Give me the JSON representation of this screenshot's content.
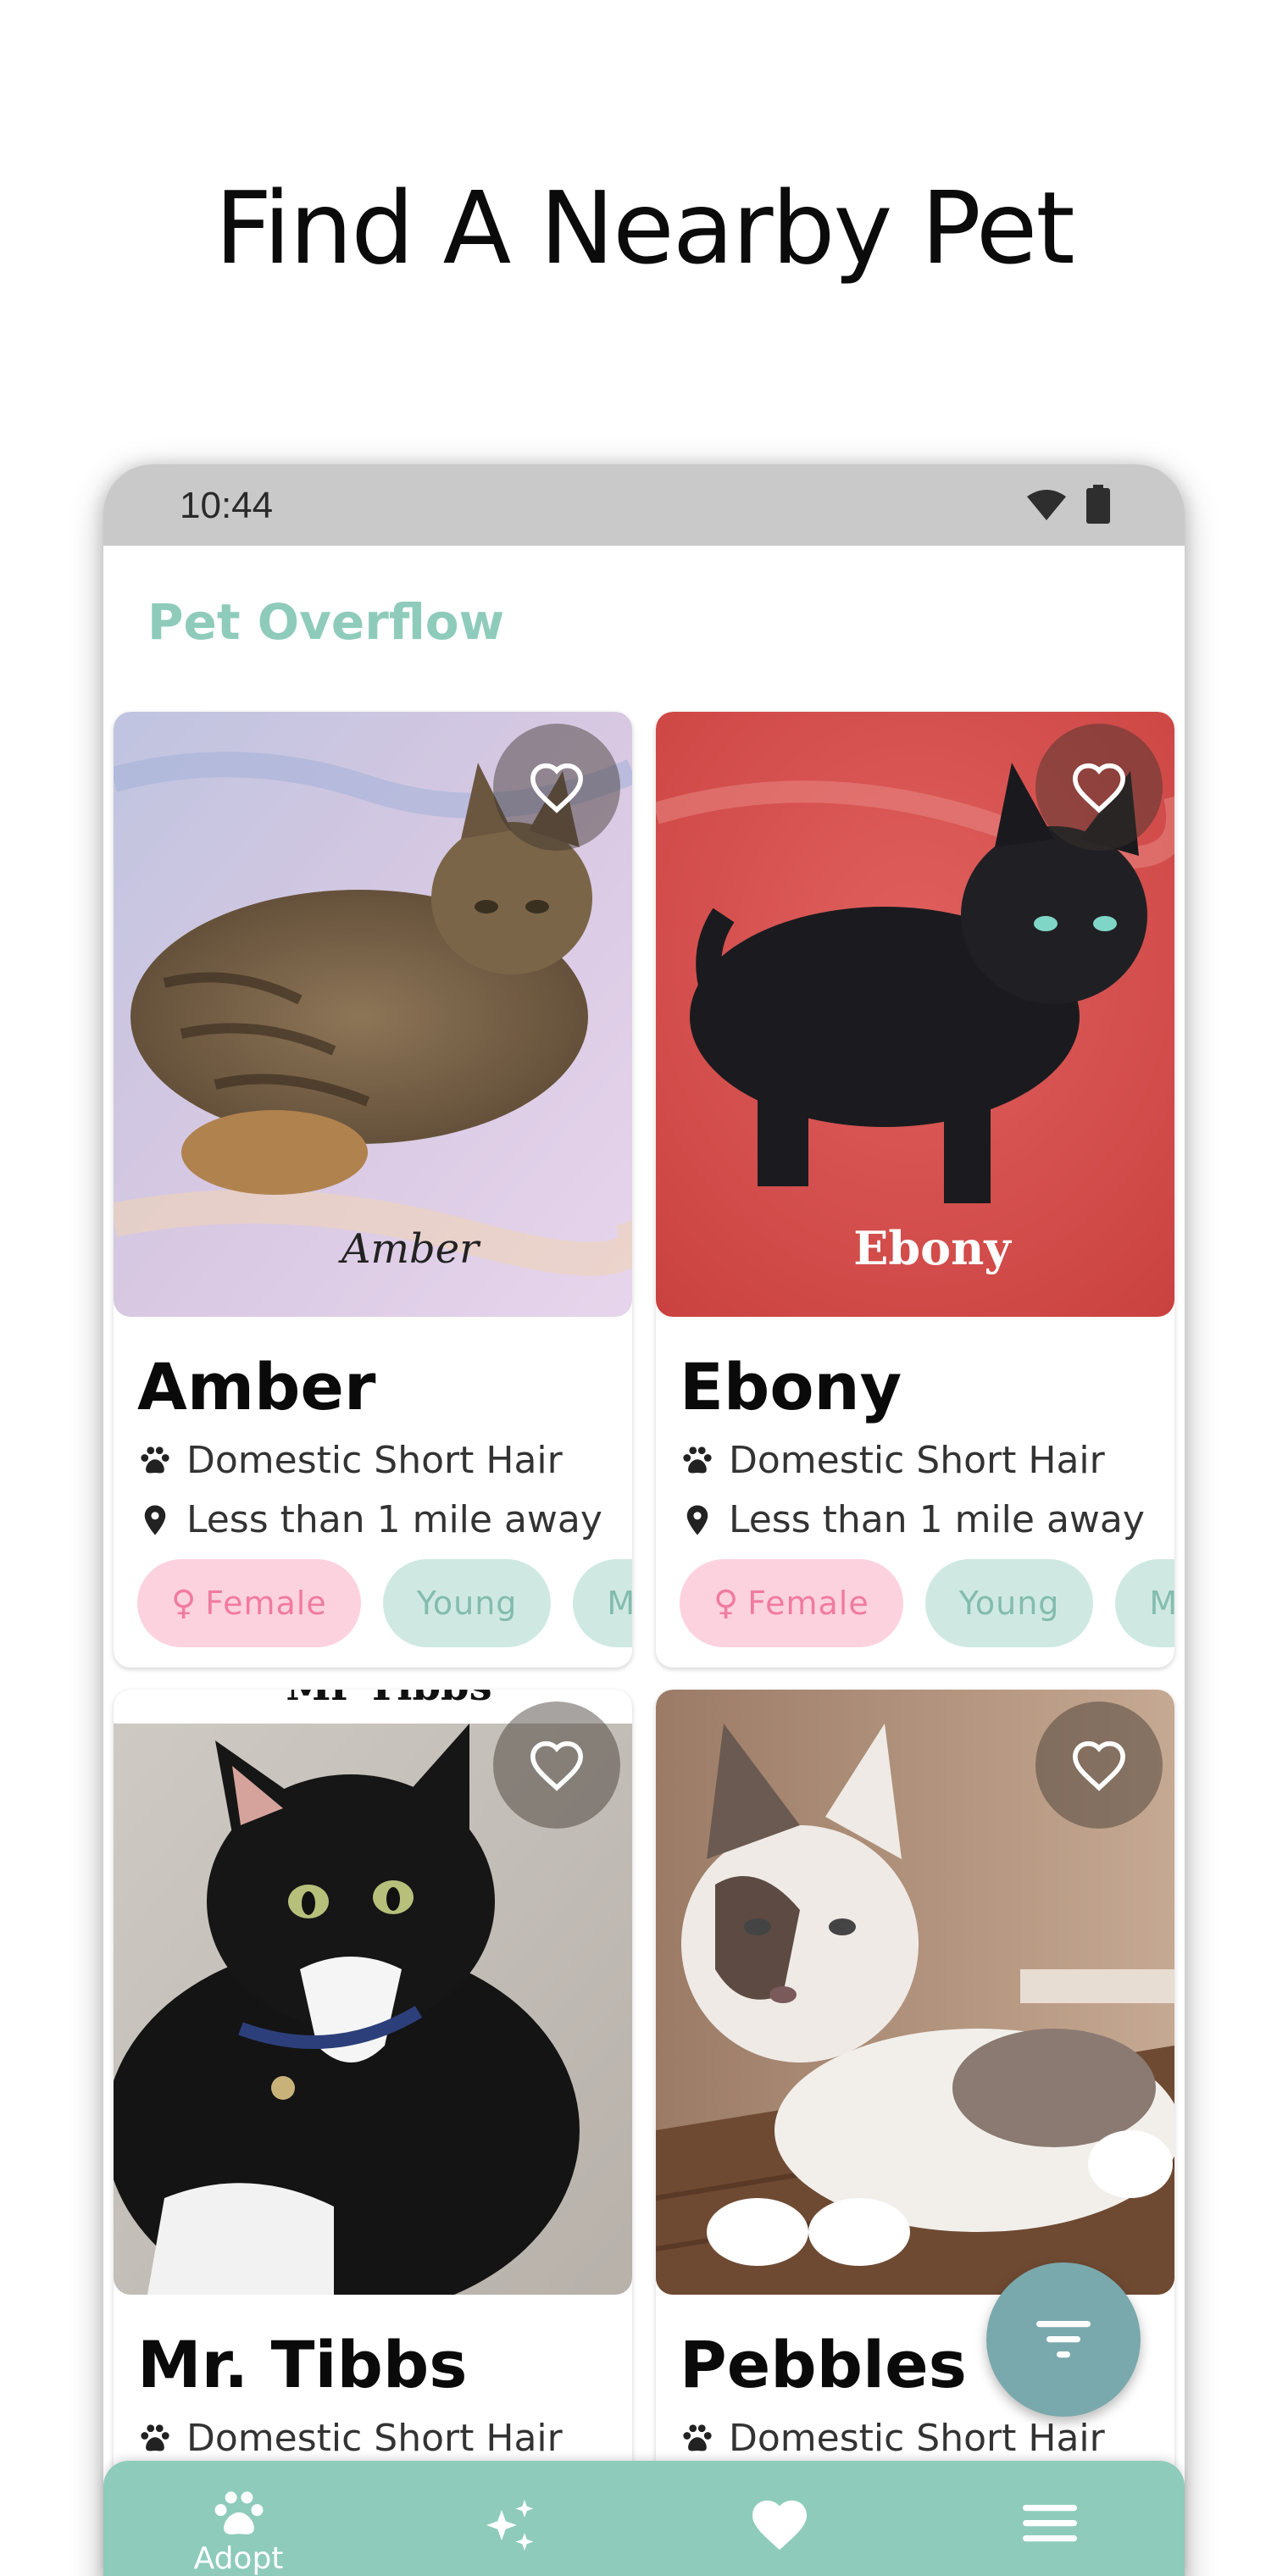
{
  "page": {
    "headline": "Find A Nearby Pet"
  },
  "status_bar": {
    "time": "10:44"
  },
  "app": {
    "title": "Pet Overflow"
  },
  "pets": [
    {
      "name": "Amber",
      "breed": "Domestic Short Hair",
      "distance": "Less than 1 mile away",
      "tags": [
        "Female",
        "Young",
        "Med"
      ],
      "photo_caption": "Amber"
    },
    {
      "name": "Ebony",
      "breed": "Domestic Short Hair",
      "distance": "Less than 1 mile away",
      "tags": [
        "Female",
        "Young",
        "Med"
      ],
      "photo_caption": "Ebony"
    },
    {
      "name": "Mr. Tibbs",
      "breed": "Domestic Short Hair",
      "photo_caption": "Mr Tibbs"
    },
    {
      "name": "Pebbles",
      "breed": "Domestic Short Hair"
    }
  ],
  "bottom_nav": {
    "items": [
      {
        "label": "Adopt",
        "icon": "paw-icon",
        "active": true
      },
      {
        "label": "",
        "icon": "sparkles-icon"
      },
      {
        "label": "",
        "icon": "heart-icon"
      },
      {
        "label": "",
        "icon": "menu-icon"
      }
    ]
  },
  "colors": {
    "accent": "#8ecbbb",
    "fab": "#7aa9ad",
    "female_chip_bg": "#fdd2df",
    "female_chip_text": "#f07ba0",
    "tag_chip_bg": "#cfe9e2",
    "tag_chip_text": "#83bcae",
    "status_bar": "#c9c9c9"
  }
}
